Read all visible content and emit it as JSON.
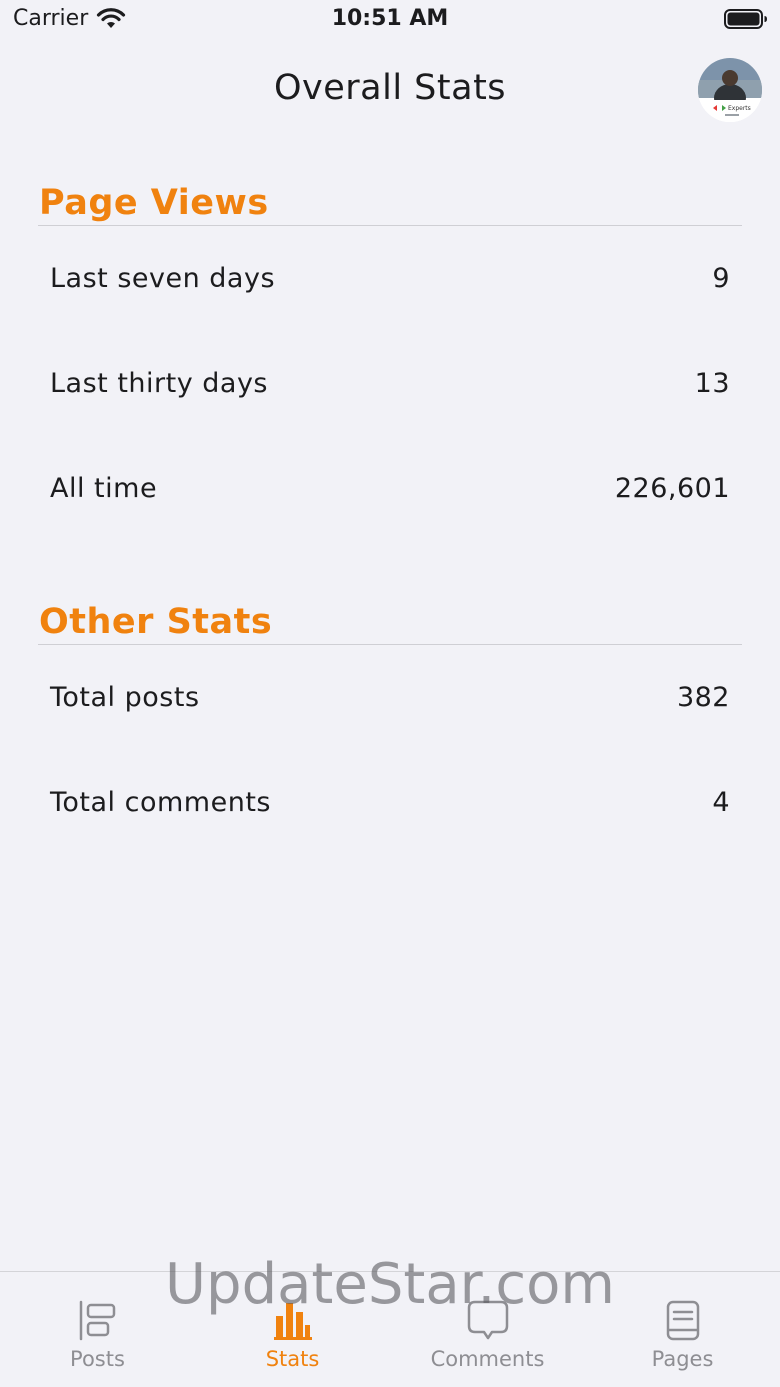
{
  "status_bar": {
    "carrier": "Carrier",
    "time": "10:51 AM"
  },
  "header": {
    "title": "Overall Stats",
    "avatar_caption": "Experts"
  },
  "sections": [
    {
      "title": "Page Views",
      "rows": [
        {
          "label": "Last seven days",
          "value": "9"
        },
        {
          "label": "Last thirty days",
          "value": "13"
        },
        {
          "label": "All time",
          "value": "226,601"
        }
      ]
    },
    {
      "title": "Other Stats",
      "rows": [
        {
          "label": "Total posts",
          "value": "382"
        },
        {
          "label": "Total comments",
          "value": "4"
        }
      ]
    }
  ],
  "tabs": [
    {
      "label": "Posts",
      "icon": "posts-icon",
      "active": false
    },
    {
      "label": "Stats",
      "icon": "stats-icon",
      "active": true
    },
    {
      "label": "Comments",
      "icon": "comments-icon",
      "active": false
    },
    {
      "label": "Pages",
      "icon": "pages-icon",
      "active": false
    }
  ],
  "colors": {
    "accent": "#f0820f",
    "background": "#f2f2f7",
    "inactive_tab": "#8e8e93"
  },
  "watermark": "UpdateStar.com"
}
